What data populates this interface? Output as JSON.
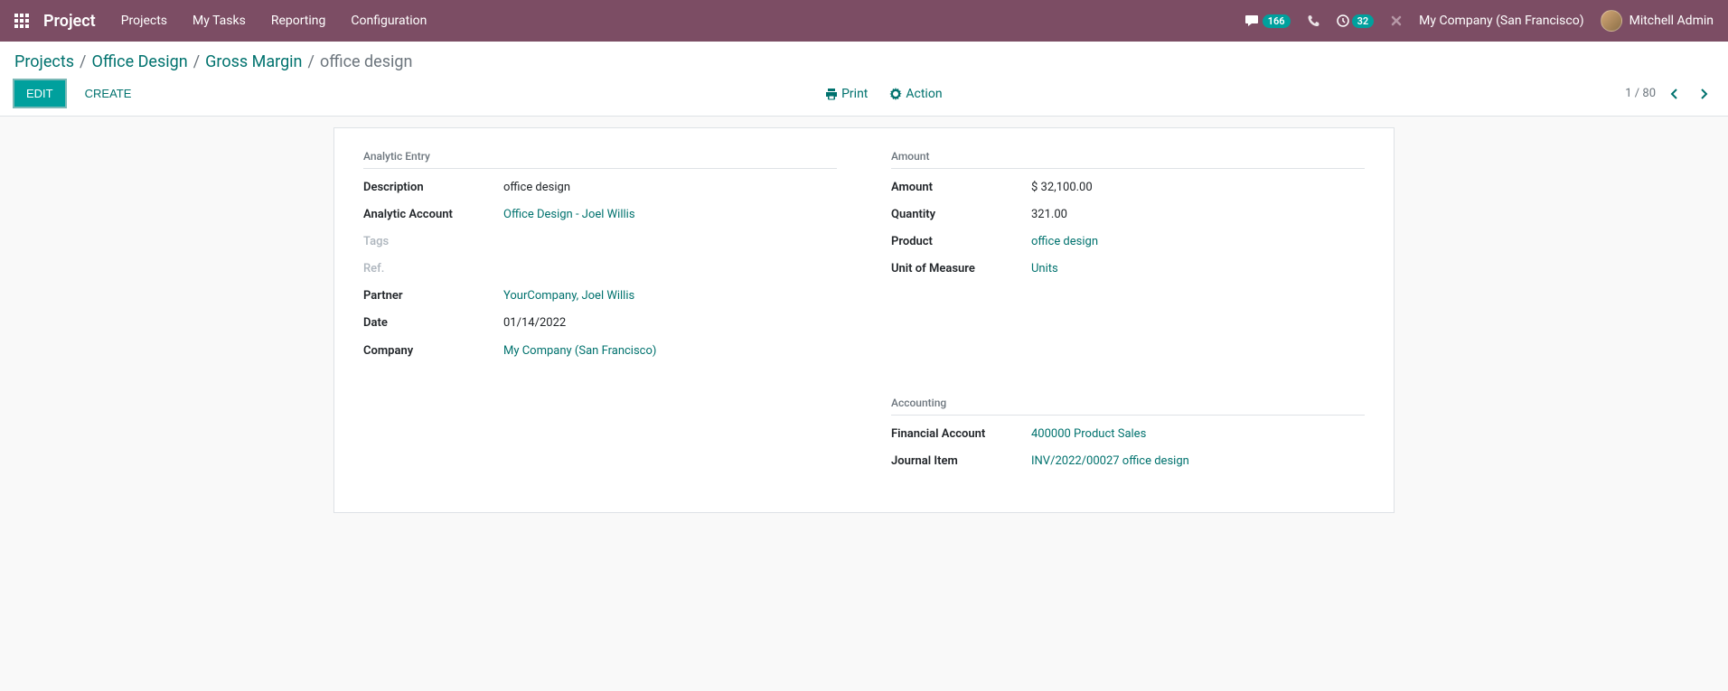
{
  "topbar": {
    "brand": "Project",
    "nav": [
      "Projects",
      "My Tasks",
      "Reporting",
      "Configuration"
    ],
    "msg_count": "166",
    "activity_count": "32",
    "company": "My Company (San Francisco)",
    "user": "Mitchell Admin"
  },
  "breadcrumbs": {
    "items": [
      "Projects",
      "Office Design",
      "Gross Margin"
    ],
    "current": "office design"
  },
  "buttons": {
    "edit": "EDIT",
    "create": "CREATE",
    "print": "Print",
    "action": "Action"
  },
  "pager": {
    "text": "1 / 80"
  },
  "sections": {
    "analytic": "Analytic Entry",
    "amount": "Amount",
    "accounting": "Accounting"
  },
  "fields": {
    "description_label": "Description",
    "description_value": "office design",
    "analytic_account_label": "Analytic Account",
    "analytic_account_value": "Office Design - Joel Willis",
    "tags_label": "Tags",
    "ref_label": "Ref.",
    "partner_label": "Partner",
    "partner_value": "YourCompany, Joel Willis",
    "date_label": "Date",
    "date_value": "01/14/2022",
    "company_label": "Company",
    "company_value": "My Company (San Francisco)",
    "amount_label": "Amount",
    "amount_value": "$ 32,100.00",
    "quantity_label": "Quantity",
    "quantity_value": "321.00",
    "product_label": "Product",
    "product_value": "office design",
    "uom_label": "Unit of Measure",
    "uom_value": "Units",
    "financial_account_label": "Financial Account",
    "financial_account_value": "400000 Product Sales",
    "journal_item_label": "Journal Item",
    "journal_item_value": "INV/2022/00027 office design"
  }
}
